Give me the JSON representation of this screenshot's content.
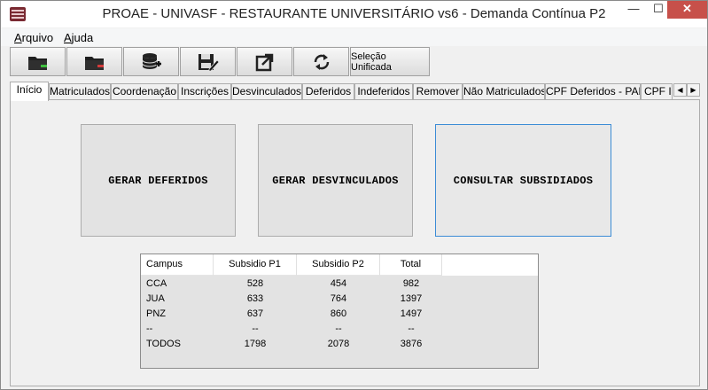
{
  "window": {
    "title": "PROAE - UNIVASF - RESTAURANTE UNIVERSITÁRIO vs6 - Demanda Contínua P2",
    "min": "—",
    "max": "☐",
    "close": "✕"
  },
  "menu": [
    {
      "first": "A",
      "rest": "rquivo"
    },
    {
      "first": "A",
      "rest": "juda"
    }
  ],
  "toolbar": {
    "icons": [
      "open-folder-green-icon",
      "open-folder-red-icon",
      "database-add-icon",
      "save-edit-icon",
      "export-icon",
      "refresh-icon"
    ],
    "text_button": "Seleção Unificada"
  },
  "tabs": [
    "Início",
    "Matriculados",
    "Coordenação",
    "Inscrições",
    "Desvinculados",
    "Deferidos",
    "Indeferidos",
    "Remover",
    "Não Matriculados",
    "CPF Deferidos - PAE",
    "CPF In"
  ],
  "tab_scroll": {
    "left": "◀",
    "right": "▶"
  },
  "actions": [
    "GERAR DEFERIDOS",
    "GERAR DESVINCULADOS",
    "CONSULTAR SUBSIDIADOS"
  ],
  "table": {
    "headers": [
      "Campus",
      "Subsidio P1",
      "Subsidio P2",
      "Total"
    ],
    "rows": [
      [
        "CCA",
        "528",
        "454",
        "982"
      ],
      [
        "JUA",
        "633",
        "764",
        "1397"
      ],
      [
        "PNZ",
        "637",
        "860",
        "1497"
      ],
      [
        "--",
        "--",
        "--",
        "--"
      ],
      [
        "TODOS",
        "1798",
        "2078",
        "3876"
      ]
    ]
  }
}
